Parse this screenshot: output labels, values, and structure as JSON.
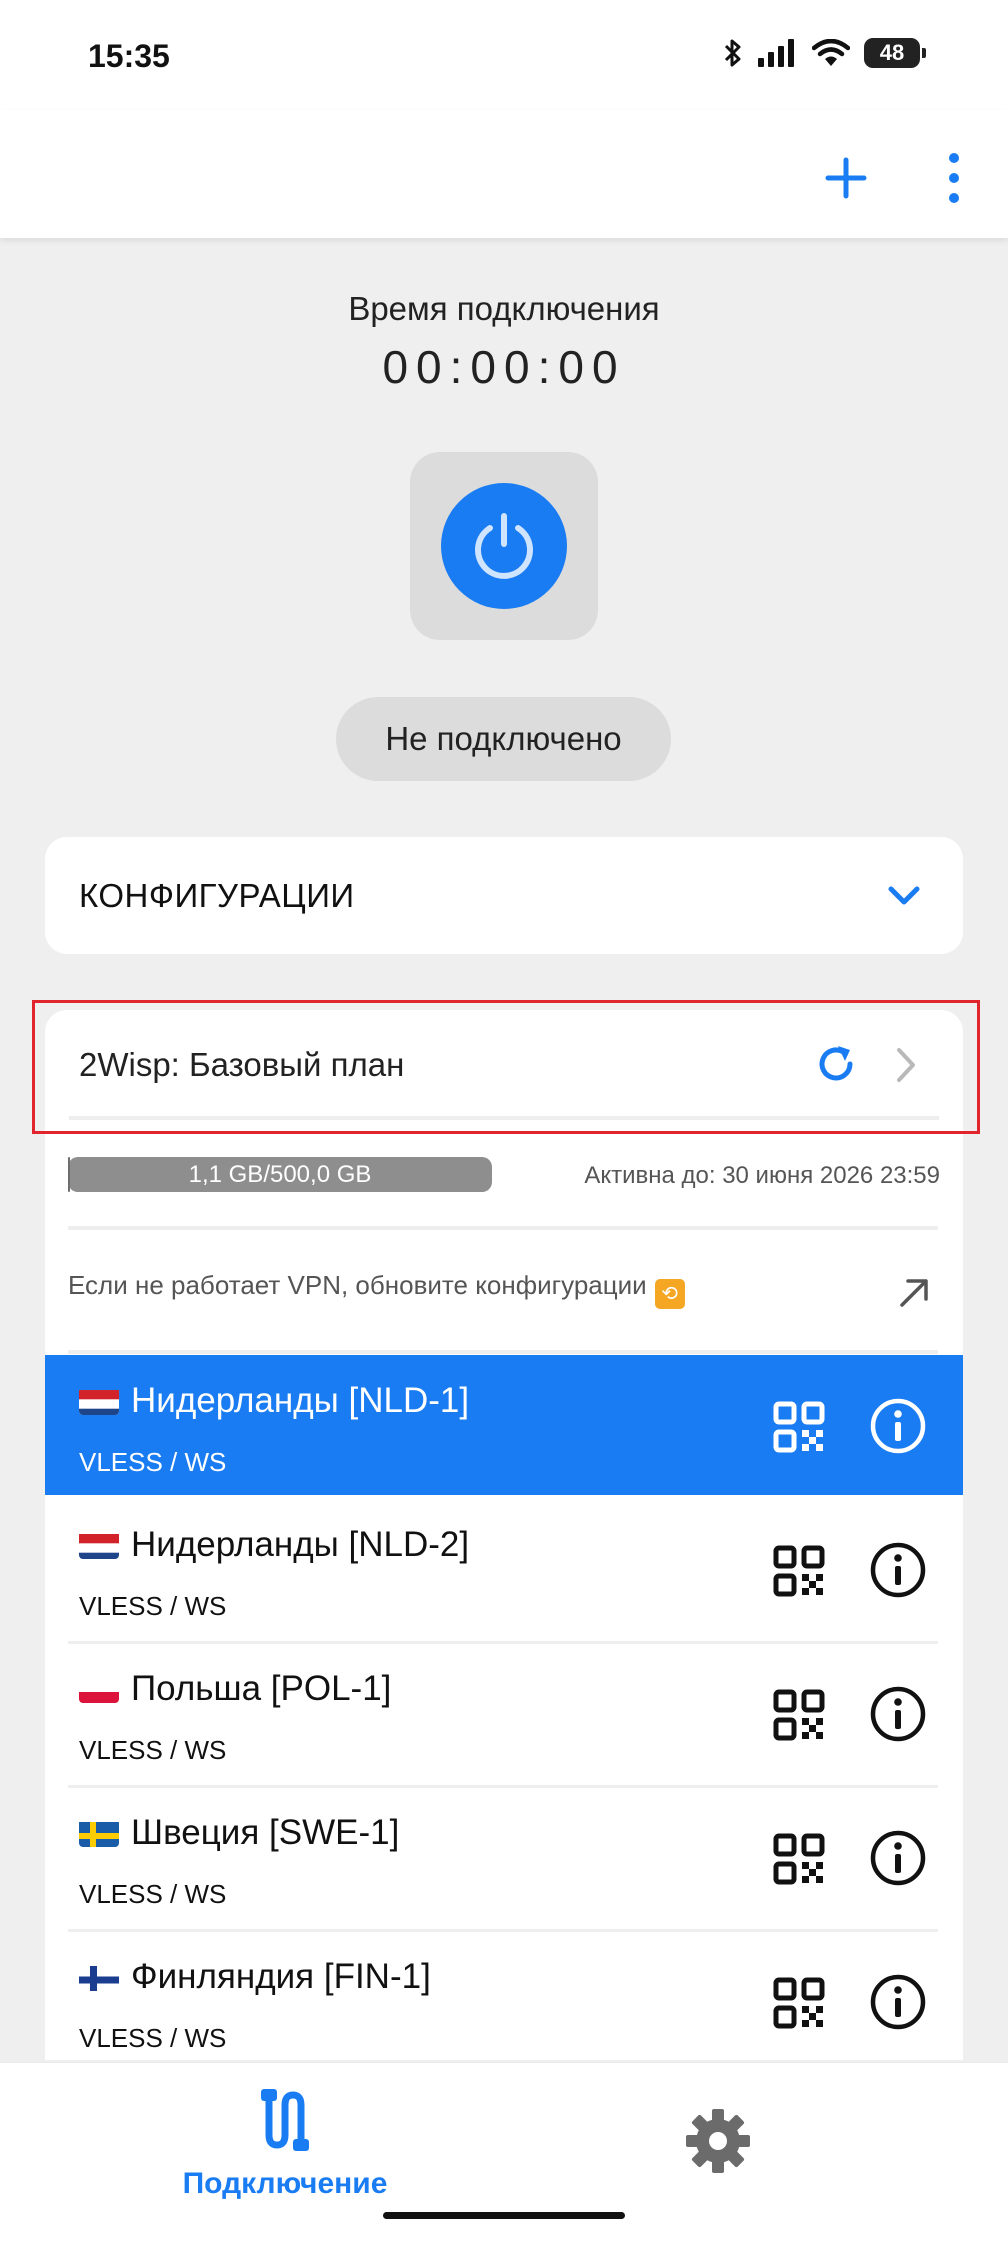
{
  "status_bar": {
    "time": "15:35",
    "battery": "48"
  },
  "app_bar": {
    "add_icon": "plus-icon",
    "menu_icon": "more-vertical-icon"
  },
  "connection": {
    "time_label": "Время подключения",
    "timer": "00:00:00",
    "status": "Не подключено"
  },
  "configs": {
    "title": "КОНФИГУРАЦИИ"
  },
  "subscription": {
    "title": "2Wisp: Базовый план",
    "traffic": "1,1 GB/500,0 GB",
    "traffic_used_fraction": 0.0022,
    "active_until": "Активна до: 30 июня 2026 23:59",
    "notice": "Если не работает VPN, обновите конфигурации"
  },
  "servers": [
    {
      "name": "Нидерланды [NLD-1]",
      "protocol": "VLESS / WS",
      "flag": "nl",
      "selected": true
    },
    {
      "name": "Нидерланды [NLD-2]",
      "protocol": "VLESS / WS",
      "flag": "nl",
      "selected": false
    },
    {
      "name": "Польша [POL-1]",
      "protocol": "VLESS / WS",
      "flag": "pl",
      "selected": false
    },
    {
      "name": "Швеция [SWE-1]",
      "protocol": "VLESS / WS",
      "flag": "se",
      "selected": false
    },
    {
      "name": "Финляндия [FIN-1]",
      "protocol": "VLESS / WS",
      "flag": "fi",
      "selected": false
    }
  ],
  "bottom_nav": {
    "connect_label": "Подключение"
  },
  "colors": {
    "accent": "#1a7cf2",
    "highlight": "#e0262c"
  }
}
